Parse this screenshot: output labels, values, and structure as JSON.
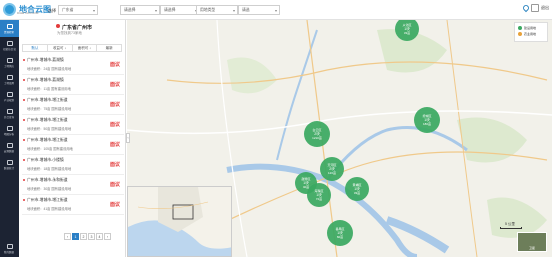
{
  "app": {
    "name": "地合云图",
    "tagline": "DIHEYUN.COM"
  },
  "filters": {
    "region_label": "选择",
    "province": "广东省",
    "city": "请选择",
    "district": "请选择",
    "type": "用地类型",
    "status": "请选"
  },
  "topright": {
    "label": "退出"
  },
  "nav": [
    {
      "label": "资源检索",
      "active": true
    },
    {
      "label": "招拍挂信息"
    },
    {
      "label": "土地供应"
    },
    {
      "label": "土地使用"
    },
    {
      "label": "产业规划"
    },
    {
      "label": "综合查询"
    },
    {
      "label": "地图分析"
    },
    {
      "label": "宏观数据"
    },
    {
      "label": "数据统计"
    },
    {
      "label": "我的数据"
    }
  ],
  "panel": {
    "title": "广东省广州市",
    "subtitle": "为您找到73家地",
    "tabs": [
      "默认",
      "收益可 ↓",
      "面积可 ↓",
      "最新"
    ],
    "items": [
      {
        "title": "广州市-增城市-荔湖镇",
        "detail": "地块面积：24亩  国有建设用地",
        "badge": "面议"
      },
      {
        "title": "广州市-增城市-荔湖镇",
        "detail": "地块面积：11亩  国有建设用地",
        "badge": "面议"
      },
      {
        "title": "广州市-增城市-增江街道",
        "detail": "地块面积：75亩  国有建设用地",
        "badge": "面议"
      },
      {
        "title": "广州市-增城市-增江街道",
        "detail": "地块面积：50亩  国有建设用地",
        "badge": "面议"
      },
      {
        "title": "广州市-增城市-增江街道",
        "detail": "地块面积：105亩  国有建设用地",
        "badge": "面议"
      },
      {
        "title": "广州市-增城市-小楼镇",
        "detail": "地块面积：18亩  国有建设用地",
        "badge": "面议"
      },
      {
        "title": "广州市-增城市-永和街道",
        "detail": "地块面积：30亩  国有建设用地",
        "badge": "面议"
      },
      {
        "title": "广州市-增城市-增江街道",
        "detail": "地块面积：41亩  国有建设用地",
        "badge": "面议"
      }
    ],
    "pages": [
      "‹",
      "1",
      "2",
      "3",
      "4",
      "›"
    ],
    "active_page": "1"
  },
  "map": {
    "legend": [
      {
        "label": "建设用地",
        "color": "#3aa961"
      },
      {
        "label": "农业用地",
        "color": "#e8a23a"
      }
    ],
    "clusters": [
      {
        "name": "从化区",
        "count": "1块",
        "area": "33亩"
      },
      {
        "name": "增城区",
        "count": "1块",
        "area": "180亩"
      },
      {
        "name": "白云区",
        "count": "2块",
        "area": "1210亩"
      },
      {
        "name": "天河区",
        "count": "2块",
        "area": "120亩"
      },
      {
        "name": "越秀区",
        "count": "1块",
        "area": "40亩"
      },
      {
        "name": "海珠区",
        "count": "1块",
        "area": "72亩"
      },
      {
        "name": "黄埔区",
        "count": "1块",
        "area": "33亩"
      },
      {
        "name": "番禺区",
        "count": "1块",
        "area": "60亩"
      }
    ],
    "scale_label": "5 公里",
    "sat_label": "卫星"
  }
}
